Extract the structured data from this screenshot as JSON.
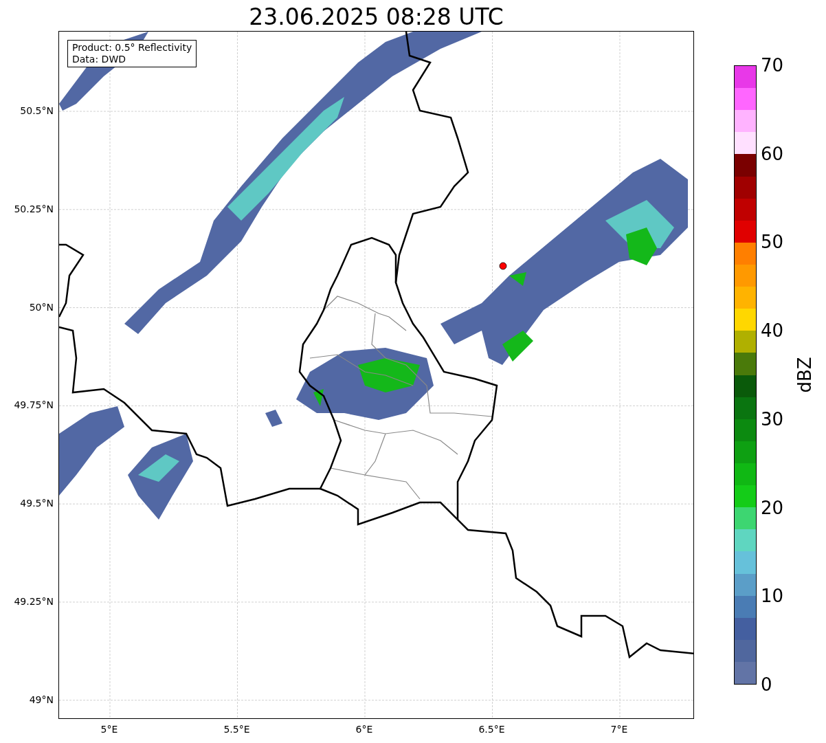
{
  "title": "23.06.2025 08:28 UTC",
  "legend": [
    "Product: 0.5° Reflectivity",
    "Data: DWD"
  ],
  "y_ticks": [
    "50.5°N",
    "50.25°N",
    "50°N",
    "49.75°N",
    "49.5°N",
    "49.25°N",
    "49°N"
  ],
  "x_ticks": [
    "5°E",
    "5.5°E",
    "6°E",
    "6.5°E",
    "7°E"
  ],
  "colorbar": {
    "label": "dBZ",
    "ticks": [
      "70",
      "60",
      "50",
      "40",
      "30",
      "20",
      "10",
      "0"
    ],
    "segments": [
      {
        "color": "#e838e8"
      },
      {
        "color": "#ff66ff"
      },
      {
        "color": "#ffb3ff"
      },
      {
        "color": "#ffe0ff"
      },
      {
        "color": "#7a0000"
      },
      {
        "color": "#a00000"
      },
      {
        "color": "#c00000"
      },
      {
        "color": "#e00000"
      },
      {
        "color": "#ff7f00"
      },
      {
        "color": "#ff9900"
      },
      {
        "color": "#ffb300"
      },
      {
        "color": "#ffd700"
      },
      {
        "color": "#b0b000"
      },
      {
        "color": "#4a7a0a"
      },
      {
        "color": "#0a5a0a"
      },
      {
        "color": "#0a7510"
      },
      {
        "color": "#0c8a10"
      },
      {
        "color": "#0ea012"
      },
      {
        "color": "#10b814"
      },
      {
        "color": "#14cc18"
      },
      {
        "color": "#3dd671"
      },
      {
        "color": "#5fd6c0"
      },
      {
        "color": "#66c1da"
      },
      {
        "color": "#5b9ec8"
      },
      {
        "color": "#4a7cb4"
      },
      {
        "color": "#445fa0"
      },
      {
        "color": "#50679e"
      },
      {
        "color": "#6274a6"
      }
    ]
  }
}
